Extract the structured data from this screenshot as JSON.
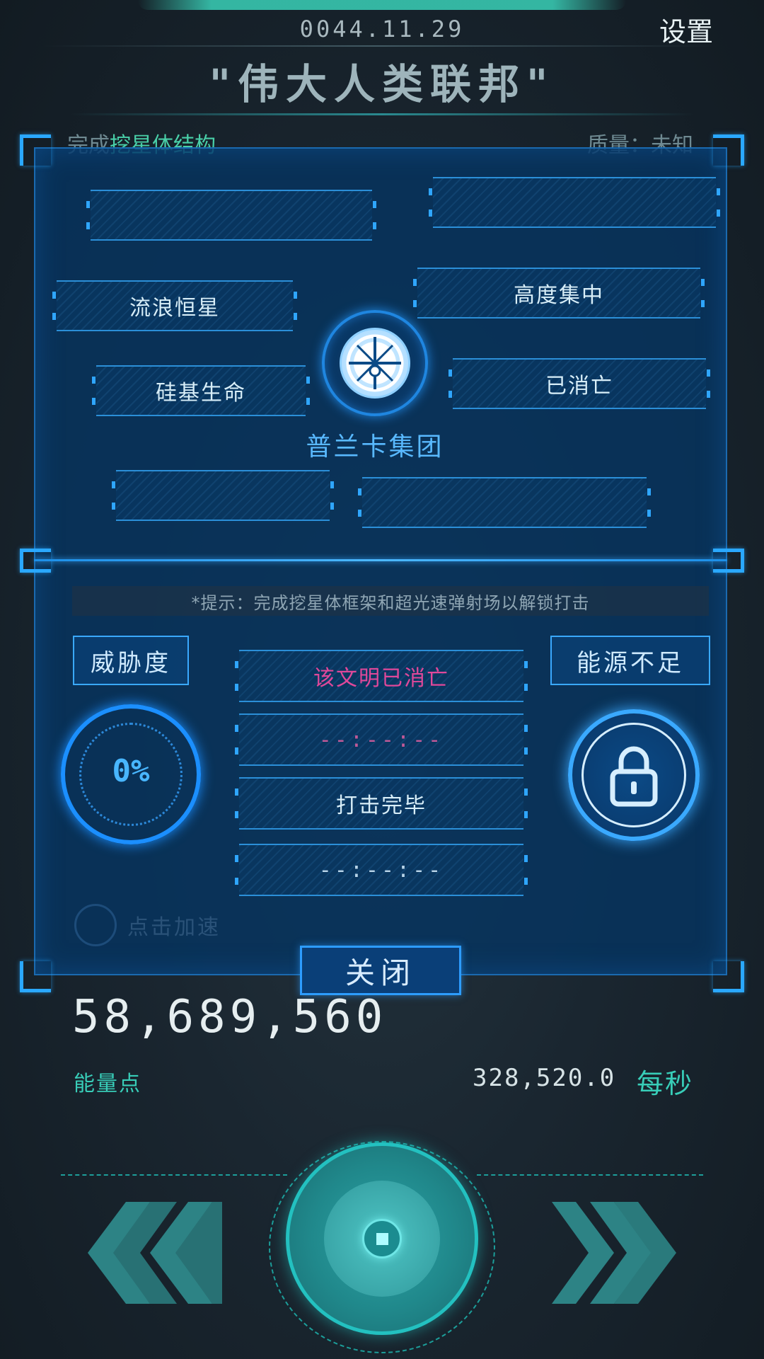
{
  "header": {
    "date": "0044.11.29",
    "settings_label": "设置",
    "title": "\"伟大人类联邦\""
  },
  "background_peek": {
    "left_prefix": "完成",
    "left_highlight": "挖星体结构",
    "right": "质量：未知"
  },
  "panel": {
    "traits": {
      "top_left": "",
      "top_right": "",
      "wandering_star": "流浪恒星",
      "highly_focused": "高度集中",
      "silicon_life": "硅基生命",
      "extinct": "已消亡",
      "bottom_left": "",
      "bottom_right": ""
    },
    "group_name": "普兰卡集团",
    "hint": "*提示：完成挖星体框架和超光速弹射场以解锁打击",
    "threat_label": "威胁度",
    "threat_value": "0%",
    "energy_status": "能源不足",
    "status_rows": [
      "该文明已消亡",
      "--:--:--",
      "打击完毕",
      "--:--:--"
    ],
    "accel_label": "点击加速",
    "close_label": "关闭"
  },
  "energy": {
    "value": "58,689,560",
    "unit": "能量点",
    "rate": "328,520.0",
    "rate_unit": "每秒"
  },
  "colors": {
    "panel_bg": "#063460",
    "accent_blue": "#2aa8ff",
    "accent_teal": "#38cdb8",
    "magenta": "#e0489a"
  },
  "icons": {
    "emblem": "planck-group-emblem",
    "lock": "lock-icon",
    "prev": "double-chevron-left-icon",
    "next": "double-chevron-right-icon"
  }
}
